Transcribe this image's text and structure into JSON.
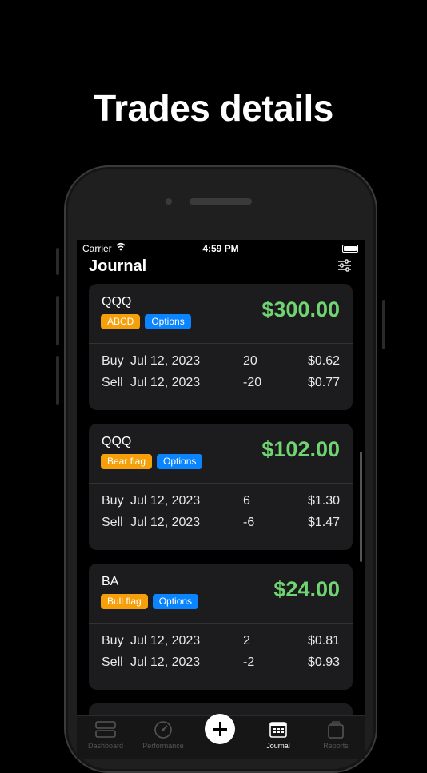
{
  "headline": "Trades details",
  "status": {
    "carrier": "Carrier",
    "time": "4:59 PM"
  },
  "nav": {
    "title": "Journal"
  },
  "trades": [
    {
      "symbol": "QQQ",
      "tags": [
        "ABCD",
        "Options"
      ],
      "pnl": "$300.00",
      "legs": [
        {
          "side": "Buy",
          "date": "Jul 12, 2023",
          "qty": "20",
          "price": "$0.62"
        },
        {
          "side": "Sell",
          "date": "Jul 12, 2023",
          "qty": "-20",
          "price": "$0.77"
        }
      ]
    },
    {
      "symbol": "QQQ",
      "tags": [
        "Bear flag",
        "Options"
      ],
      "pnl": "$102.00",
      "legs": [
        {
          "side": "Buy",
          "date": "Jul 12, 2023",
          "qty": "6",
          "price": "$1.30"
        },
        {
          "side": "Sell",
          "date": "Jul 12, 2023",
          "qty": "-6",
          "price": "$1.47"
        }
      ]
    },
    {
      "symbol": "BA",
      "tags": [
        "Bull flag",
        "Options"
      ],
      "pnl": "$24.00",
      "legs": [
        {
          "side": "Buy",
          "date": "Jul 12, 2023",
          "qty": "2",
          "price": "$0.81"
        },
        {
          "side": "Sell",
          "date": "Jul 12, 2023",
          "qty": "-2",
          "price": "$0.93"
        }
      ]
    }
  ],
  "tabbar": {
    "items": [
      {
        "label": "Dashboard",
        "icon": "dashboard-icon"
      },
      {
        "label": "Performance",
        "icon": "gauge-icon"
      },
      {
        "label": "",
        "icon": "add-icon"
      },
      {
        "label": "Journal",
        "icon": "calendar-icon",
        "active": true
      },
      {
        "label": "Reports",
        "icon": "reports-icon"
      }
    ]
  },
  "colors": {
    "profit": "#6fd471",
    "tag_setup": "#f5a00a",
    "tag_type": "#0a84ff",
    "card_bg": "#1c1c1e"
  }
}
